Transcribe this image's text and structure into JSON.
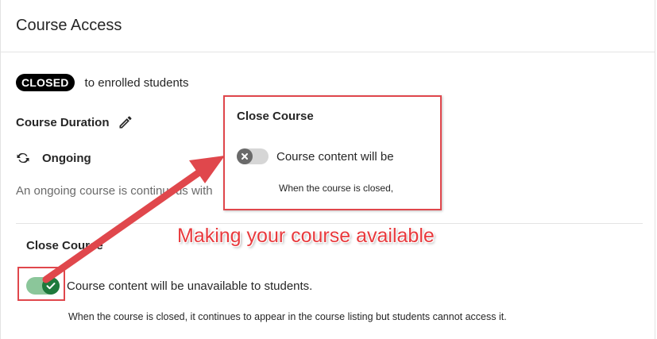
{
  "header": {
    "title": "Course Access"
  },
  "status": {
    "badge": "CLOSED",
    "text": "to enrolled students"
  },
  "duration": {
    "label": "Course Duration",
    "value": "Ongoing",
    "description": "An ongoing course is continuous with"
  },
  "close_course": {
    "title": "Close Course",
    "toggle_label": "Course content will be unavailable to students.",
    "toggle_on": true,
    "subtext": "When the course is closed, it continues to appear in the course listing but students cannot access it."
  },
  "popout": {
    "title": "Close Course",
    "toggle_label": "Course content will be",
    "toggle_on": false,
    "subtext": "When the course is closed,"
  },
  "annotation": {
    "caption": "Making your course available",
    "color": "#e83a3d"
  },
  "colors": {
    "badge_bg": "#000000",
    "toggle_on_track": "#8bc69a",
    "toggle_on_knob": "#1e7a3c",
    "toggle_off_knob": "#6a6a6a",
    "highlight": "#e0474c"
  }
}
